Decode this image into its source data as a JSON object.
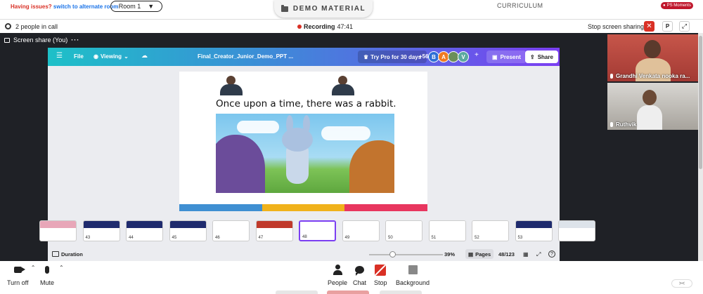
{
  "top": {
    "issues_prefix": "Having issues?",
    "issues_link": "switch to alternate room",
    "room": "Room 1",
    "demo_material": "DEMO MATERIAL",
    "curriculum": "CURRICULUM",
    "ps_badge": "PS Moments"
  },
  "call": {
    "people_count": "2 people in call",
    "recording_label": "Recording",
    "recording_time": "47:41",
    "stop_screen_sharing": "Stop screen sharing",
    "p_button": "P"
  },
  "share": {
    "header": "Screen share (You)"
  },
  "canva": {
    "file": "File",
    "viewing": "Viewing",
    "doc_name": "Final_Creator_Junior_Demo_PPT ...",
    "try_pro": "Try Pro for 30 days",
    "extra_users": "+56",
    "avatars": [
      {
        "letter": "B",
        "color": "#2f6fd6"
      },
      {
        "letter": "A",
        "color": "#f07b22"
      },
      {
        "letter": "",
        "color": "#6b8f5a"
      },
      {
        "letter": "V",
        "color": "#5aa9a0"
      }
    ],
    "present": "Present",
    "share": "Share",
    "slide_text": "Once upon a time, there was a rabbit.",
    "bar_colors": [
      "#3f8fd2",
      "#f0b21b",
      "#e8365f"
    ],
    "thumbnails": [
      {
        "num": "",
        "color": "#e8a6b8"
      },
      {
        "num": "43",
        "color": "#1f2b6e"
      },
      {
        "num": "44",
        "color": "#1f2b6e"
      },
      {
        "num": "45",
        "color": "#1f2b6e"
      },
      {
        "num": "46",
        "color": "#ffffff"
      },
      {
        "num": "47",
        "color": "#c0392b"
      },
      {
        "num": "48",
        "color": "#ffffff"
      },
      {
        "num": "49",
        "color": "#ffffff"
      },
      {
        "num": "50",
        "color": "#ffffff"
      },
      {
        "num": "51",
        "color": "#ffffff"
      },
      {
        "num": "52",
        "color": "#ffffff"
      },
      {
        "num": "53",
        "color": "#1f2b6e"
      },
      {
        "num": "",
        "color": "#dde3ea"
      }
    ],
    "active_thumb": 48,
    "duration": "Duration",
    "zoom": "39%",
    "pages": "Pages",
    "page_count": "48/123",
    "help": "?"
  },
  "participants": [
    {
      "name": "Grandhi Venkata nooka ra..."
    },
    {
      "name": "Ruthvik"
    }
  ],
  "toolbar": {
    "turn_off": "Turn off",
    "mute": "Mute",
    "people": "People",
    "chat": "Chat",
    "stop": "Stop",
    "background": "Background"
  },
  "colors": {
    "accent_red": "#d93025",
    "accent_blue": "#1a73e8",
    "canva_purple": "#7b3ff2",
    "dark_bg": "#1f2126"
  }
}
